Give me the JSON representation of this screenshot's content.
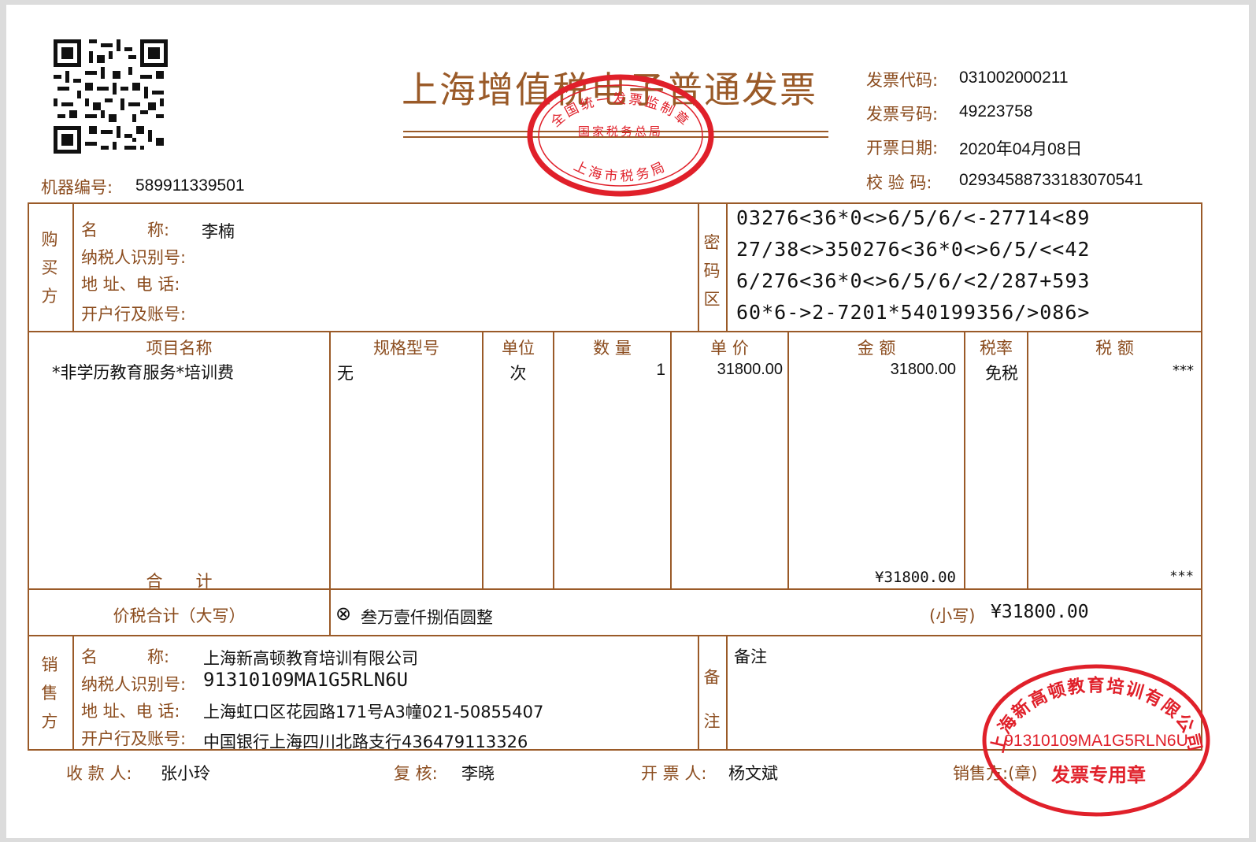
{
  "invoice": {
    "title": "上海增值税电子普通发票",
    "machine_no_label": "机器编号:",
    "machine_no": "589911339501",
    "code_label": "发票代码:",
    "code": "031002000211",
    "number_label": "发票号码:",
    "number": "49223758",
    "date_label": "开票日期:",
    "date": "2020年04月08日",
    "check_label": "校 验 码:",
    "check": "02934588733183070541"
  },
  "buyer": {
    "section": [
      "购",
      "买",
      "方"
    ],
    "name_label": "名　　　称:",
    "name": "李楠",
    "tax_id_label": "纳税人识别号:",
    "address_label": "地 址、电 话:",
    "bank_label": "开户行及账号:"
  },
  "cipher": {
    "section": [
      "密",
      "码",
      "区"
    ],
    "lines": [
      "03276<36*0<>6/5/6/<-27714<89",
      "27/38<>350276<36*0<>6/5/<<42",
      "6/276<36*0<>6/5/6/<2/287+593",
      "60*6->2-7201*540199356/>086>"
    ]
  },
  "items": {
    "headers": {
      "name": "项目名称",
      "spec": "规格型号",
      "unit": "单位",
      "qty": "数 量",
      "price": "单 价",
      "amount": "金 额",
      "rate": "税率",
      "tax": "税 额"
    },
    "row": {
      "name": "*非学历教育服务*培训费",
      "spec": "无",
      "unit": "次",
      "qty": "1",
      "price": "31800.00",
      "amount": "31800.00",
      "rate": "免税",
      "tax": "***"
    },
    "total_label": "合　　计",
    "total_amount": "¥31800.00",
    "total_tax": "***"
  },
  "grand_total": {
    "label": "价税合计（大写）",
    "words_icon": "⊗",
    "words": "叁万壹仟捌佰圆整",
    "small_label": "(小写)",
    "small": "¥31800.00"
  },
  "seller": {
    "section": [
      "销",
      "售",
      "方"
    ],
    "name_label": "名　　　称:",
    "name": "上海新高顿教育培训有限公司",
    "tax_id_label": "纳税人识别号:",
    "tax_id": "91310109MA1G5RLN6U",
    "address_label": "地 址、电 话:",
    "address": "上海虹口区花园路171号A3幢021-50855407",
    "bank_label": "开户行及账号:",
    "bank": "中国银行上海四川北路支行436479113326"
  },
  "remarks": {
    "section": [
      "备",
      "注"
    ],
    "label": "备注"
  },
  "footer": {
    "payee_label": "收 款 人:",
    "payee": "张小玲",
    "reviewer_label": "复 核:",
    "reviewer": "李晓",
    "issuer_label": "开 票 人:",
    "issuer": "杨文斌",
    "seller_label": "销售方:(章)"
  },
  "stamps": {
    "tax_bureau": {
      "top": "全国统一发票监制章",
      "middle": "国家税务总局",
      "bottom": "上海市税务局"
    },
    "seller": {
      "top": "上海新高顿教育培训有限公司",
      "middle": "91310109MA1G5RLN6U",
      "bottom": "发票专用章"
    },
    "color": "#e0202a"
  },
  "icons": {
    "qr": "qr-code-icon",
    "check": "circled-x-icon"
  }
}
